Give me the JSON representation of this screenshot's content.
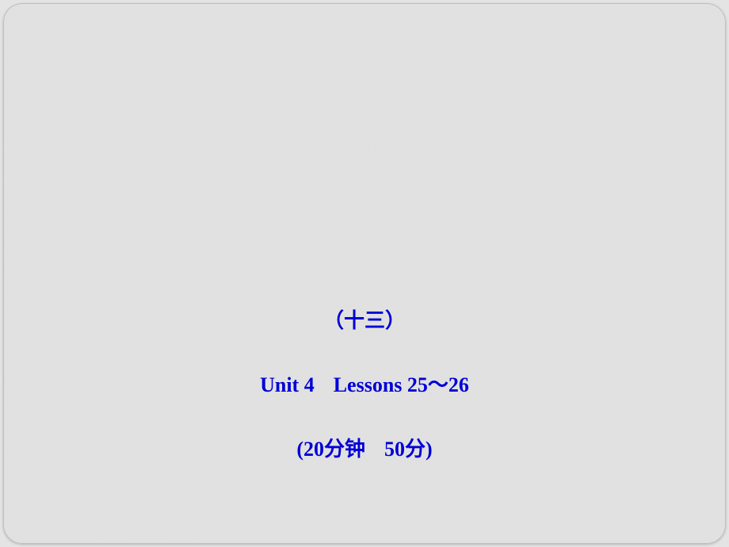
{
  "slide": {
    "line1": "（十三）",
    "line2_unit": "Unit 4",
    "line2_lessons": "Lessons 25～26",
    "line3_open": "(20",
    "line3_min": "分钟",
    "line3_score": "50",
    "line3_pts": "分",
    "line3_close": ")"
  }
}
